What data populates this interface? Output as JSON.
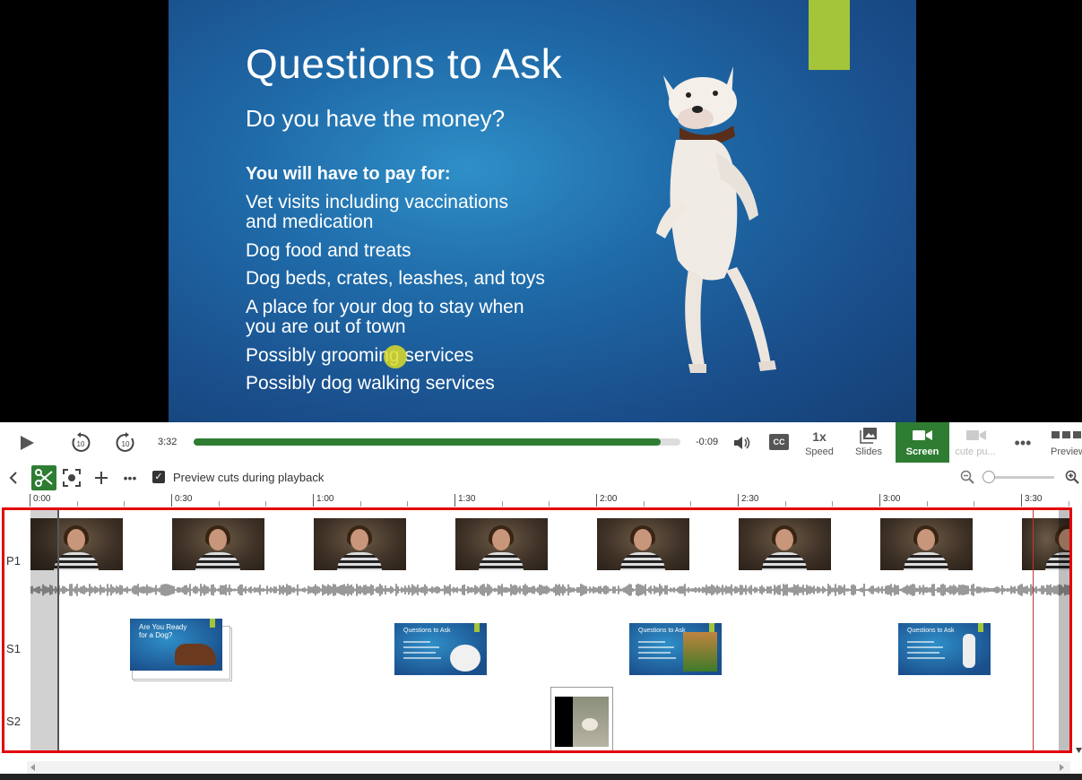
{
  "slide": {
    "title": "Questions to Ask",
    "subtitle": "Do you have the money?",
    "lead": "You will have to pay for:",
    "bullets": [
      "Vet visits including vaccinations",
      "and medication",
      "Dog food and treats",
      "Dog beds, crates, leashes, and toys",
      "A place for your dog to stay when",
      "you are out of town",
      "Possibly grooming services",
      "Possibly dog walking services"
    ],
    "accent_color": "#a4c43a"
  },
  "transport": {
    "current_time": "3:32",
    "remaining_time": "-0:09",
    "progress_fraction": 0.96,
    "rewind_label": "10",
    "forward_label": "10",
    "speed_value": "1x",
    "speed_label": "Speed",
    "slides_label": "Slides",
    "screen_label": "Screen",
    "cut_label": "cute pu...",
    "preview_label": "Preview",
    "cc_label": "CC"
  },
  "edit_toolbar": {
    "preview_cuts_label": "Preview cuts during playback",
    "preview_cuts_checked": true
  },
  "ruler": {
    "ticks": [
      "0:00",
      "0:30",
      "1:00",
      "1:30",
      "2:00",
      "2:30",
      "3:00",
      "3:30"
    ]
  },
  "tracks": {
    "p1_label": "P1",
    "s1_label": "S1",
    "s2_label": "S2"
  },
  "s1_thumbs": [
    {
      "title": "Are You Ready for a Dog?"
    },
    {
      "title": "Questions to Ask"
    },
    {
      "title": "Questions to Ask"
    },
    {
      "title": "Questions to Ask"
    }
  ],
  "colors": {
    "accent_green": "#2e7d32",
    "highlight_red": "#e3000b",
    "playhead": "#c0392b"
  }
}
